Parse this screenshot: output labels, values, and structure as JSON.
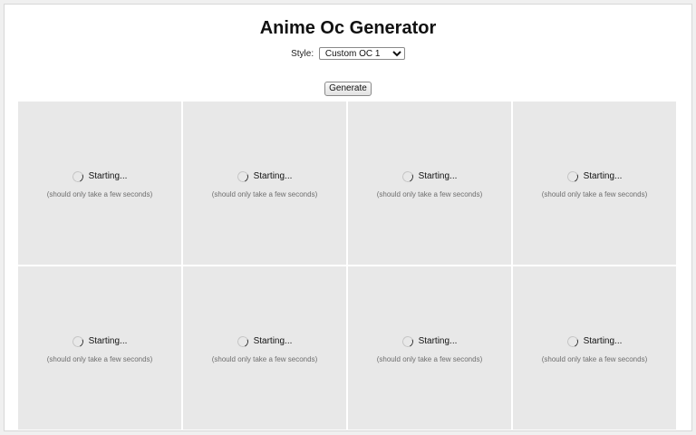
{
  "page": {
    "title": "Anime Oc Generator"
  },
  "controls": {
    "style_label": "Style:",
    "style_selected": "Custom OC 1",
    "generate_label": "Generate"
  },
  "grid": {
    "cells": [
      {
        "status": "Starting...",
        "hint": "(should only take a few seconds)"
      },
      {
        "status": "Starting...",
        "hint": "(should only take a few seconds)"
      },
      {
        "status": "Starting...",
        "hint": "(should only take a few seconds)"
      },
      {
        "status": "Starting...",
        "hint": "(should only take a few seconds)"
      },
      {
        "status": "Starting...",
        "hint": "(should only take a few seconds)"
      },
      {
        "status": "Starting...",
        "hint": "(should only take a few seconds)"
      },
      {
        "status": "Starting...",
        "hint": "(should only take a few seconds)"
      },
      {
        "status": "Starting...",
        "hint": "(should only take a few seconds)"
      }
    ]
  },
  "icons": {
    "spinner": "loading-spinner-icon"
  },
  "colors": {
    "cell_background": "#e8e8e8",
    "hint_text": "#6e6e6e"
  }
}
